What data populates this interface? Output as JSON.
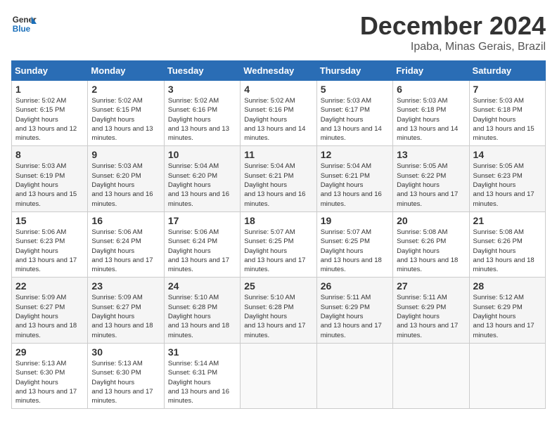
{
  "header": {
    "logo_line1": "General",
    "logo_line2": "Blue",
    "month": "December 2024",
    "location": "Ipaba, Minas Gerais, Brazil"
  },
  "weekdays": [
    "Sunday",
    "Monday",
    "Tuesday",
    "Wednesday",
    "Thursday",
    "Friday",
    "Saturday"
  ],
  "weeks": [
    [
      {
        "day": "1",
        "sunrise": "5:02 AM",
        "sunset": "6:15 PM",
        "daylight": "13 hours and 12 minutes."
      },
      {
        "day": "2",
        "sunrise": "5:02 AM",
        "sunset": "6:15 PM",
        "daylight": "13 hours and 13 minutes."
      },
      {
        "day": "3",
        "sunrise": "5:02 AM",
        "sunset": "6:16 PM",
        "daylight": "13 hours and 13 minutes."
      },
      {
        "day": "4",
        "sunrise": "5:02 AM",
        "sunset": "6:16 PM",
        "daylight": "13 hours and 14 minutes."
      },
      {
        "day": "5",
        "sunrise": "5:03 AM",
        "sunset": "6:17 PM",
        "daylight": "13 hours and 14 minutes."
      },
      {
        "day": "6",
        "sunrise": "5:03 AM",
        "sunset": "6:18 PM",
        "daylight": "13 hours and 14 minutes."
      },
      {
        "day": "7",
        "sunrise": "5:03 AM",
        "sunset": "6:18 PM",
        "daylight": "13 hours and 15 minutes."
      }
    ],
    [
      {
        "day": "8",
        "sunrise": "5:03 AM",
        "sunset": "6:19 PM",
        "daylight": "13 hours and 15 minutes."
      },
      {
        "day": "9",
        "sunrise": "5:03 AM",
        "sunset": "6:20 PM",
        "daylight": "13 hours and 16 minutes."
      },
      {
        "day": "10",
        "sunrise": "5:04 AM",
        "sunset": "6:20 PM",
        "daylight": "13 hours and 16 minutes."
      },
      {
        "day": "11",
        "sunrise": "5:04 AM",
        "sunset": "6:21 PM",
        "daylight": "13 hours and 16 minutes."
      },
      {
        "day": "12",
        "sunrise": "5:04 AM",
        "sunset": "6:21 PM",
        "daylight": "13 hours and 16 minutes."
      },
      {
        "day": "13",
        "sunrise": "5:05 AM",
        "sunset": "6:22 PM",
        "daylight": "13 hours and 17 minutes."
      },
      {
        "day": "14",
        "sunrise": "5:05 AM",
        "sunset": "6:23 PM",
        "daylight": "13 hours and 17 minutes."
      }
    ],
    [
      {
        "day": "15",
        "sunrise": "5:06 AM",
        "sunset": "6:23 PM",
        "daylight": "13 hours and 17 minutes."
      },
      {
        "day": "16",
        "sunrise": "5:06 AM",
        "sunset": "6:24 PM",
        "daylight": "13 hours and 17 minutes."
      },
      {
        "day": "17",
        "sunrise": "5:06 AM",
        "sunset": "6:24 PM",
        "daylight": "13 hours and 17 minutes."
      },
      {
        "day": "18",
        "sunrise": "5:07 AM",
        "sunset": "6:25 PM",
        "daylight": "13 hours and 17 minutes."
      },
      {
        "day": "19",
        "sunrise": "5:07 AM",
        "sunset": "6:25 PM",
        "daylight": "13 hours and 18 minutes."
      },
      {
        "day": "20",
        "sunrise": "5:08 AM",
        "sunset": "6:26 PM",
        "daylight": "13 hours and 18 minutes."
      },
      {
        "day": "21",
        "sunrise": "5:08 AM",
        "sunset": "6:26 PM",
        "daylight": "13 hours and 18 minutes."
      }
    ],
    [
      {
        "day": "22",
        "sunrise": "5:09 AM",
        "sunset": "6:27 PM",
        "daylight": "13 hours and 18 minutes."
      },
      {
        "day": "23",
        "sunrise": "5:09 AM",
        "sunset": "6:27 PM",
        "daylight": "13 hours and 18 minutes."
      },
      {
        "day": "24",
        "sunrise": "5:10 AM",
        "sunset": "6:28 PM",
        "daylight": "13 hours and 18 minutes."
      },
      {
        "day": "25",
        "sunrise": "5:10 AM",
        "sunset": "6:28 PM",
        "daylight": "13 hours and 17 minutes."
      },
      {
        "day": "26",
        "sunrise": "5:11 AM",
        "sunset": "6:29 PM",
        "daylight": "13 hours and 17 minutes."
      },
      {
        "day": "27",
        "sunrise": "5:11 AM",
        "sunset": "6:29 PM",
        "daylight": "13 hours and 17 minutes."
      },
      {
        "day": "28",
        "sunrise": "5:12 AM",
        "sunset": "6:29 PM",
        "daylight": "13 hours and 17 minutes."
      }
    ],
    [
      {
        "day": "29",
        "sunrise": "5:13 AM",
        "sunset": "6:30 PM",
        "daylight": "13 hours and 17 minutes."
      },
      {
        "day": "30",
        "sunrise": "5:13 AM",
        "sunset": "6:30 PM",
        "daylight": "13 hours and 17 minutes."
      },
      {
        "day": "31",
        "sunrise": "5:14 AM",
        "sunset": "6:31 PM",
        "daylight": "13 hours and 16 minutes."
      },
      null,
      null,
      null,
      null
    ]
  ]
}
